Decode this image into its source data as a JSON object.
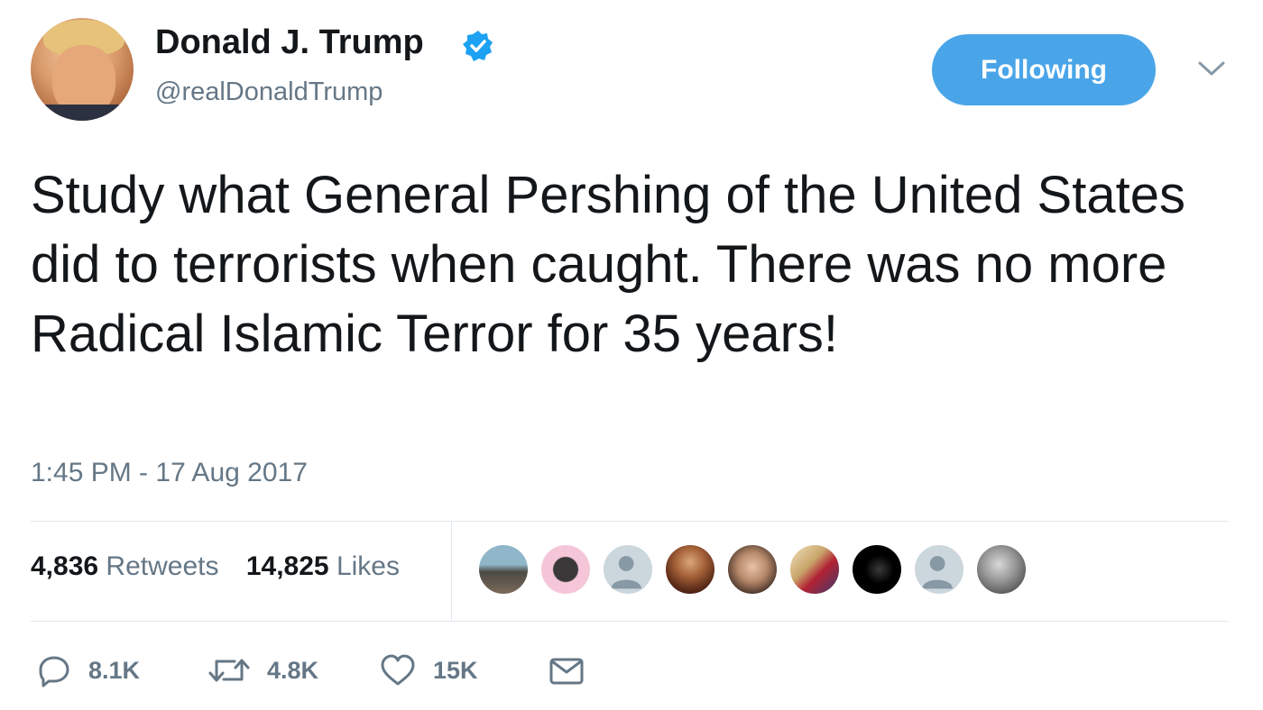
{
  "author": {
    "display_name": "Donald J. Trump",
    "handle": "@realDonaldTrump",
    "verified": true
  },
  "follow_button": {
    "label": "Following"
  },
  "tweet": {
    "text": "Study what General Pershing of the United States did to terrorists when caught. There was no more Radical Islamic Terror for 35 years!",
    "timestamp": "1:45 PM - 17 Aug 2017"
  },
  "stats": {
    "retweets_count": "4,836",
    "retweets_label": "Retweets",
    "likes_count": "14,825",
    "likes_label": "Likes"
  },
  "actions": {
    "reply_count": "8.1K",
    "retweet_count": "4.8K",
    "like_count": "15K"
  },
  "colors": {
    "accent": "#4aa5e8",
    "muted_text": "#657786",
    "divider": "#e1e8ed"
  },
  "icons": [
    "verified-badge-icon",
    "chevron-down-icon",
    "reply-icon",
    "retweet-icon",
    "heart-icon",
    "mail-icon"
  ]
}
